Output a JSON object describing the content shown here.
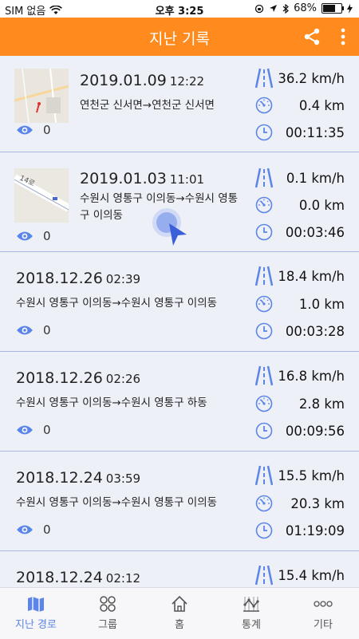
{
  "status": {
    "carrier": "SIM 없음",
    "time": "오후 3:25",
    "battery": "68%",
    "battery_level": 0.68
  },
  "header": {
    "title": "지난 기록"
  },
  "records": [
    {
      "date": "2019.01.09",
      "time": "12:22",
      "route": "연천군 신서면→연천군 신서면",
      "views": "0",
      "speed": "36.2 km/h",
      "distance": "0.4 km",
      "duration": "00:11:35",
      "has_thumbnail": true
    },
    {
      "date": "2019.01.03",
      "time": "11:01",
      "route": "수원시 영통구 이의동→수원시 영통구 이의동",
      "views": "0",
      "speed": "0.1 km/h",
      "distance": "0.0 km",
      "duration": "00:03:46",
      "has_thumbnail": true,
      "thumb_text": "14로"
    },
    {
      "date": "2018.12.26",
      "time": "02:39",
      "route": "수원시 영통구 이의동→수원시 영통구 이의동",
      "views": "0",
      "speed": "18.4 km/h",
      "distance": "1.0 km",
      "duration": "00:03:28",
      "has_thumbnail": false
    },
    {
      "date": "2018.12.26",
      "time": "02:26",
      "route": "수원시 영통구 이의동→수원시 영통구 하동",
      "views": "0",
      "speed": "16.8 km/h",
      "distance": "2.8 km",
      "duration": "00:09:56",
      "has_thumbnail": false
    },
    {
      "date": "2018.12.24",
      "time": "03:59",
      "route": "수원시 영통구 이의동→수원시 영통구 이의동",
      "views": "0",
      "speed": "15.5 km/h",
      "distance": "20.3 km",
      "duration": "01:19:09",
      "has_thumbnail": false
    },
    {
      "date": "2018.12.24",
      "time": "02:12",
      "speed": "15.4 km/h",
      "has_thumbnail": false
    }
  ],
  "tabs": [
    {
      "label": "지난 경로",
      "active": true
    },
    {
      "label": "그룹",
      "active": false
    },
    {
      "label": "홈",
      "active": false
    },
    {
      "label": "통계",
      "active": false
    },
    {
      "label": "기타",
      "active": false
    }
  ],
  "colors": {
    "header": "#ff8a1d",
    "accent": "#5b85e8",
    "background": "#eef0f8",
    "divider": "#a9b6e0"
  }
}
